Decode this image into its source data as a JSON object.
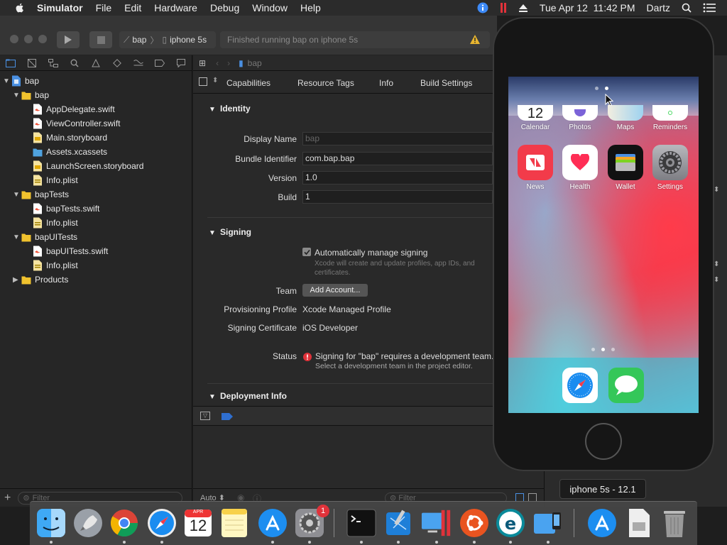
{
  "menubar": {
    "app_name": "Simulator",
    "items": [
      "File",
      "Edit",
      "Hardware",
      "Debug",
      "Window",
      "Help"
    ],
    "clock": "Tue Apr 12  11:42 PM",
    "user": "Dartz"
  },
  "toolbar": {
    "scheme": "bap",
    "device": "iphone 5s",
    "activity": "Finished running bap on iphone 5s"
  },
  "navigator": {
    "project": "bap",
    "groups": [
      {
        "name": "bap",
        "files": [
          "AppDelegate.swift",
          "ViewController.swift",
          "Main.storyboard",
          "Assets.xcassets",
          "LaunchScreen.storyboard",
          "Info.plist"
        ]
      },
      {
        "name": "bapTests",
        "files": [
          "bapTests.swift",
          "Info.plist"
        ]
      },
      {
        "name": "bapUITests",
        "files": [
          "bapUITests.swift",
          "Info.plist"
        ]
      },
      {
        "name": "Products",
        "files": []
      }
    ],
    "filter_placeholder": "Filter"
  },
  "editor": {
    "breadcrumb": "bap",
    "tabs": [
      "Capabilities",
      "Resource Tags",
      "Info",
      "Build Settings"
    ],
    "identity": {
      "title": "Identity",
      "display_name_label": "Display Name",
      "display_name_placeholder": "bap",
      "bundle_id_label": "Bundle Identifier",
      "bundle_id": "com.bap.bap",
      "version_label": "Version",
      "version": "1.0",
      "build_label": "Build",
      "build": "1"
    },
    "signing": {
      "title": "Signing",
      "auto_label": "Automatically manage signing",
      "auto_checked": true,
      "auto_help": "Xcode will create and update profiles, app IDs, and certificates.",
      "team_label": "Team",
      "team_button": "Add Account...",
      "profile_label": "Provisioning Profile",
      "profile": "Xcode Managed Profile",
      "cert_label": "Signing Certificate",
      "cert": "iOS Developer",
      "status_label": "Status",
      "status_msg": "Signing for \"bap\" requires a development team.",
      "status_hint": "Select a development team in the project editor."
    },
    "deployment_title": "Deployment Info",
    "bottom_auto": "Auto",
    "bottom_filter_placeholder": "Filter"
  },
  "simulator": {
    "device_label": "iphone 5s - 12.1",
    "apps_row1": [
      "Calendar",
      "Photos",
      "Maps",
      "Reminders"
    ],
    "apps_row2": [
      "News",
      "Health",
      "Wallet",
      "Settings"
    ],
    "calendar_day": "12",
    "page_count": 3,
    "current_page": 2
  },
  "dock": {
    "calendar_month": "APR",
    "calendar_day": "12",
    "settings_badge": "1"
  },
  "colors": {
    "xcode_blue": "#4a90e2",
    "warning_red": "#e0323a",
    "news_red": "#f23b4a",
    "health_red": "#ff2d55",
    "messages_green": "#34c759"
  }
}
